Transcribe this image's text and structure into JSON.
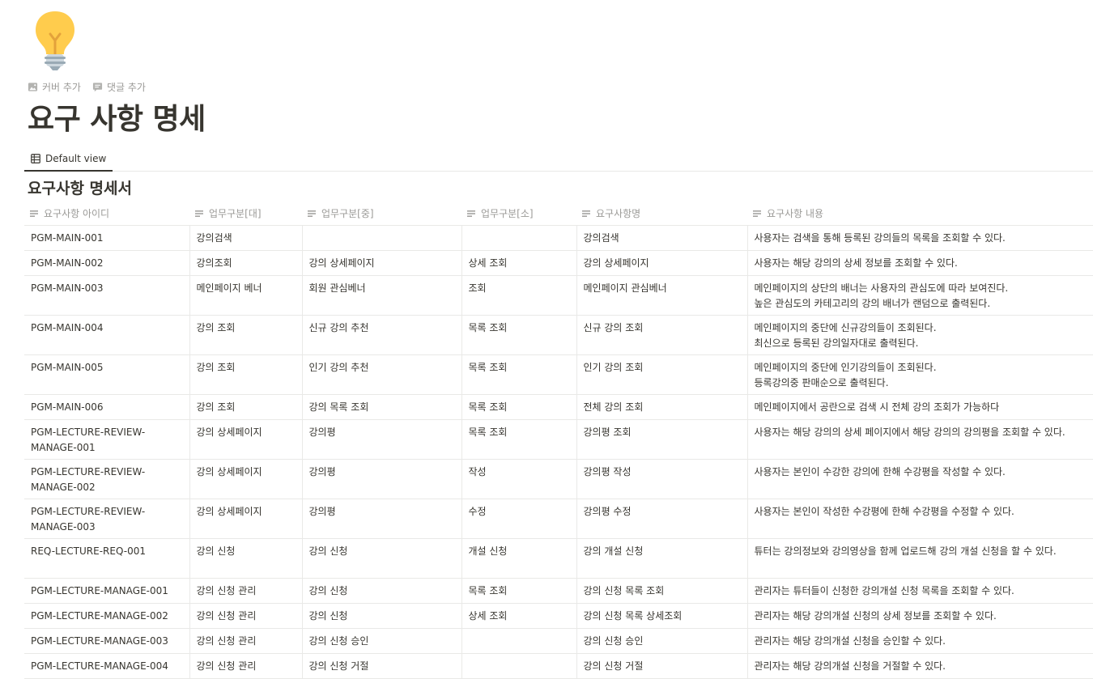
{
  "page": {
    "icon": "lightbulb-icon",
    "add_cover": "커버 추가",
    "add_comment": "댓글 추가",
    "title": "요구 사항 명세"
  },
  "views": [
    {
      "label": "Default view",
      "icon": "table-icon"
    }
  ],
  "database": {
    "title": "요구사항 명세서",
    "columns": [
      "요구사항 아이디",
      "업무구분[대]",
      "업무구분[중]",
      "업무구분[소]",
      "요구사항명",
      "요구사항 내용"
    ],
    "rows": [
      {
        "id": "PGM-MAIN-001",
        "major": "강의검색",
        "middle": "",
        "minor": "",
        "name": "강의검색",
        "desc": "사용자는 검색을 통해 등록된 강의들의 목록을 조회할 수 있다."
      },
      {
        "id": "PGM-MAIN-002",
        "major": "강의조회",
        "middle": "강의 상세페이지",
        "minor": "상세 조회",
        "name": "강의 상세페이지",
        "desc": "사용자는 해당 강의의 상세 정보를 조회할 수 있다."
      },
      {
        "id": "PGM-MAIN-003",
        "major": "메인페이지 베너",
        "middle": "회원 관심베너",
        "minor": "조회",
        "name": "메인페이지 관심베너",
        "desc": "메인페이지의 상단의 배너는 사용자의 관심도에 따라 보여진다.\n높은 관심도의 카테고리의 강의 배너가 랜덤으로 출력된다."
      },
      {
        "id": "PGM-MAIN-004",
        "major": "강의 조회",
        "middle": "신규 강의 추천",
        "minor": "목록 조회",
        "name": "신규 강의 조회",
        "desc": "메인페이지의 중단에 신규강의들이 조회된다.\n최신으로 등록된 강의일자대로 출력된다."
      },
      {
        "id": "PGM-MAIN-005",
        "major": "강의 조회",
        "middle": "인기 강의 추천",
        "minor": "목록 조회",
        "name": "인기 강의 조회",
        "desc": "메인페이지의 중단에 인기강의들이 조회된다.\n등록강의중 판매순으로 출력된다."
      },
      {
        "id": "PGM-MAIN-006",
        "major": "강의 조회",
        "middle": "강의 목록 조회",
        "minor": "목록 조회",
        "name": "전체 강의 조회",
        "desc": "메인페이지에서 공란으로 검색 시 전체 강의 조회가 가능하다"
      },
      {
        "id": "PGM-LECTURE-REVIEW-MANAGE-001",
        "major": "강의 상세페이지",
        "middle": "강의평",
        "minor": "목록 조회",
        "name": "강의평 조회",
        "desc": "사용자는 해당 강의의 상세 페이지에서 해당 강의의 강의평을 조회할 수 있다."
      },
      {
        "id": "PGM-LECTURE-REVIEW-MANAGE-002",
        "major": "강의 상세페이지",
        "middle": "강의평",
        "minor": "작성",
        "name": "강의평 작성",
        "desc": "사용자는 본인이 수강한 강의에 한해 수강평을 작성할 수 있다."
      },
      {
        "id": "PGM-LECTURE-REVIEW-MANAGE-003",
        "major": "강의 상세페이지",
        "middle": "강의평",
        "minor": "수정",
        "name": "강의평 수정",
        "desc": "사용자는 본인이 작성한 수강평에 한해 수강평을 수정할 수 있다."
      },
      {
        "id": "REQ-LECTURE-REQ-001",
        "major": "강의 신청",
        "middle": "강의 신청",
        "minor": "개설 신청",
        "name": "강의 개설 신청",
        "desc": "튜터는 강의정보와 강의영상을 함께 업로드해 강의 개설 신청을 할 수 있다."
      },
      {
        "id": "PGM-LECTURE-MANAGE-001",
        "major": "강의 신청 관리",
        "middle": "강의 신청",
        "minor": "목록 조회",
        "name": "강의 신청 목록 조회",
        "desc": "관리자는 튜터들이 신청한 강의개설 신청 목록을 조회할 수 있다."
      },
      {
        "id": "PGM-LECTURE-MANAGE-002",
        "major": "강의 신청 관리",
        "middle": "강의 신청",
        "minor": "상세 조회",
        "name": "강의 신청 목록 상세조회",
        "desc": "관리자는 해당 강의개설 신청의 상세 정보를 조회할 수 있다."
      },
      {
        "id": "PGM-LECTURE-MANAGE-003",
        "major": "강의 신청 관리",
        "middle": "강의 신청 승인",
        "minor": "",
        "name": "강의 신청 승인",
        "desc": "관리자는 해당 강의개설 신청을 승인할 수 있다."
      },
      {
        "id": "PGM-LECTURE-MANAGE-004",
        "major": "강의 신청 관리",
        "middle": "강의 신청 거절",
        "minor": "",
        "name": "강의 신청 거절",
        "desc": "관리자는 해당 강의개설 신청을 거절할 수 있다."
      }
    ]
  },
  "colors": {
    "text": "#37352f",
    "muted": "#9b9a97",
    "divider": "#e9e9e7",
    "bulb": "#FFCC4D"
  }
}
